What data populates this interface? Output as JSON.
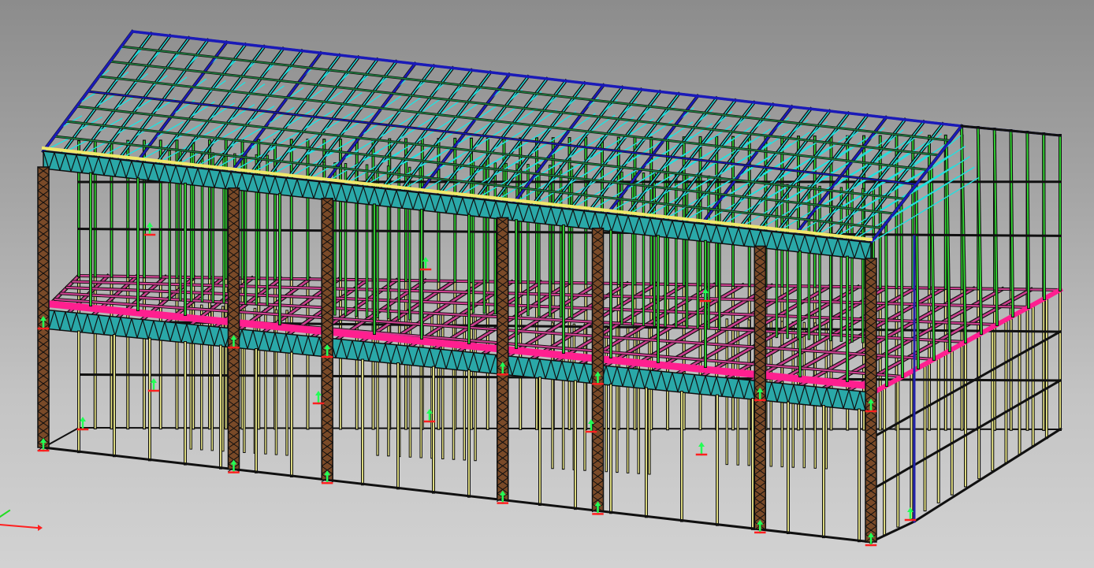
{
  "viewport": {
    "background_top": "#8c8c8c",
    "background_bottom": "#d2d2d2"
  },
  "model": {
    "name": "light-gauge-steel-frame-building",
    "stories": 2,
    "bays_front": 8,
    "colors": {
      "outline": "#101010",
      "ground_floor_studs": "#f2ef8c",
      "upper_floor_studs": "#33dd33",
      "roof_trusses": "#22e0e0",
      "roof_chords": "#1a1ab8",
      "floor_joists": "#cc3f8f",
      "floor_edge_beam": "#ff1f8f",
      "floor_truss": "#2aa8a8",
      "columns": "#7a4a28",
      "top_plate": "#f0e86a",
      "support_up_marker": "#22ff55",
      "support_down_marker": "#ff2020"
    }
  },
  "axis_triad": {
    "x_color": "#ff2020",
    "y_color": "#22dd22"
  }
}
